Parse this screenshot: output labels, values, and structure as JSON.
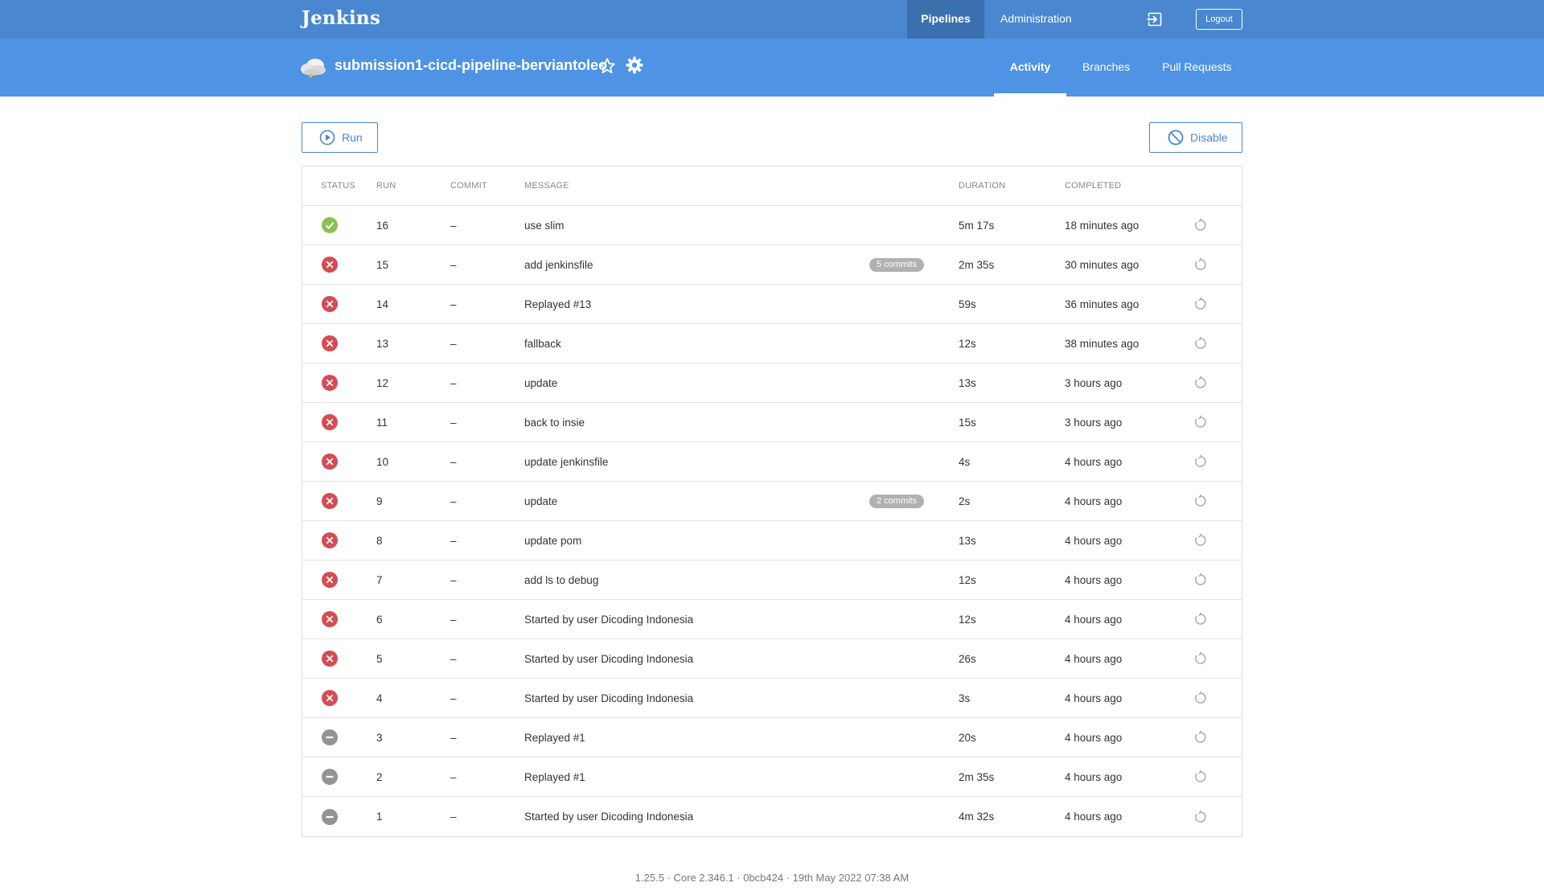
{
  "app": {
    "brand": "Jenkins"
  },
  "topnav": {
    "items": [
      "Pipelines",
      "Administration"
    ],
    "active": "Pipelines",
    "logout_label": "Logout"
  },
  "pipeline": {
    "name": "submission1-cicd-pipeline-berviantoleo"
  },
  "tabs": {
    "items": [
      "Activity",
      "Branches",
      "Pull Requests"
    ],
    "active": "Activity"
  },
  "actions": {
    "run_label": "Run",
    "disable_label": "Disable"
  },
  "colors": {
    "topbar": "#4a87d0",
    "subheader": "#4e93e4",
    "success": "#8cc04f",
    "failure": "#d54c53",
    "aborted": "#949393"
  },
  "table": {
    "headers": [
      "STATUS",
      "RUN",
      "COMMIT",
      "MESSAGE",
      "DURATION",
      "COMPLETED"
    ],
    "rows": [
      {
        "status": "success",
        "run": "16",
        "commit": "–",
        "message": "use slim",
        "badge": "",
        "duration": "5m 17s",
        "completed": "18 minutes ago"
      },
      {
        "status": "failure",
        "run": "15",
        "commit": "–",
        "message": "add jenkinsfile",
        "badge": "5 commits",
        "duration": "2m 35s",
        "completed": "30 minutes ago"
      },
      {
        "status": "failure",
        "run": "14",
        "commit": "–",
        "message": "Replayed #13",
        "badge": "",
        "duration": "59s",
        "completed": "36 minutes ago"
      },
      {
        "status": "failure",
        "run": "13",
        "commit": "–",
        "message": "fallback",
        "badge": "",
        "duration": "12s",
        "completed": "38 minutes ago"
      },
      {
        "status": "failure",
        "run": "12",
        "commit": "–",
        "message": "update",
        "badge": "",
        "duration": "13s",
        "completed": "3 hours ago"
      },
      {
        "status": "failure",
        "run": "11",
        "commit": "–",
        "message": "back to insie",
        "badge": "",
        "duration": "15s",
        "completed": "3 hours ago"
      },
      {
        "status": "failure",
        "run": "10",
        "commit": "–",
        "message": "update jenkinsfile",
        "badge": "",
        "duration": "4s",
        "completed": "4 hours ago"
      },
      {
        "status": "failure",
        "run": "9",
        "commit": "–",
        "message": "update",
        "badge": "2 commits",
        "duration": "2s",
        "completed": "4 hours ago"
      },
      {
        "status": "failure",
        "run": "8",
        "commit": "–",
        "message": "update pom",
        "badge": "",
        "duration": "13s",
        "completed": "4 hours ago"
      },
      {
        "status": "failure",
        "run": "7",
        "commit": "–",
        "message": "add ls to debug",
        "badge": "",
        "duration": "12s",
        "completed": "4 hours ago"
      },
      {
        "status": "failure",
        "run": "6",
        "commit": "–",
        "message": "Started by user Dicoding Indonesia",
        "badge": "",
        "duration": "12s",
        "completed": "4 hours ago"
      },
      {
        "status": "failure",
        "run": "5",
        "commit": "–",
        "message": "Started by user Dicoding Indonesia",
        "badge": "",
        "duration": "26s",
        "completed": "4 hours ago"
      },
      {
        "status": "failure",
        "run": "4",
        "commit": "–",
        "message": "Started by user Dicoding Indonesia",
        "badge": "",
        "duration": "3s",
        "completed": "4 hours ago"
      },
      {
        "status": "aborted",
        "run": "3",
        "commit": "–",
        "message": "Replayed #1",
        "badge": "",
        "duration": "20s",
        "completed": "4 hours ago"
      },
      {
        "status": "aborted",
        "run": "2",
        "commit": "–",
        "message": "Replayed #1",
        "badge": "",
        "duration": "2m 35s",
        "completed": "4 hours ago"
      },
      {
        "status": "aborted",
        "run": "1",
        "commit": "–",
        "message": "Started by user Dicoding Indonesia",
        "badge": "",
        "duration": "4m 32s",
        "completed": "4 hours ago"
      }
    ]
  },
  "footer": {
    "text": "1.25.5 · Core 2.346.1 · 0bcb424 · 19th May 2022 07:38 AM"
  }
}
